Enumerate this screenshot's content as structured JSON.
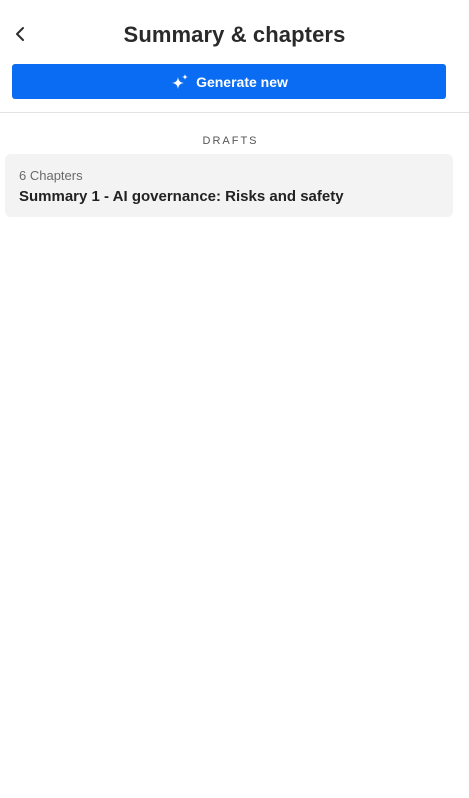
{
  "header": {
    "back_icon": "chevron-left-icon",
    "title": "Summary & chapters"
  },
  "actions": {
    "generate_label": "Generate new",
    "generate_icon": "sparkle-icon",
    "accent_color": "#0a6cf2"
  },
  "drafts": {
    "section_label": "DRAFTS",
    "items": [
      {
        "meta": "6 Chapters",
        "title": "Summary 1 - AI governance: Risks and safety"
      }
    ]
  }
}
